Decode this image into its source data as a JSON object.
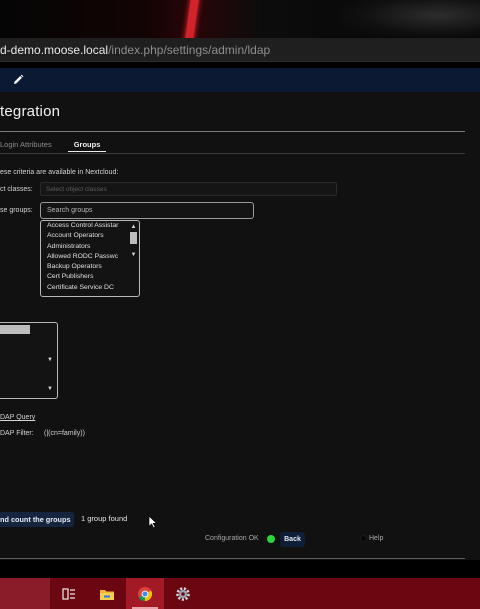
{
  "browser": {
    "url_host": "d-demo.moose.local",
    "url_path": "/index.php/settings/admin/ldap"
  },
  "header": {
    "edit_icon": "pencil-icon"
  },
  "page": {
    "title": "tegration",
    "tabs": [
      {
        "label": "Login Attributes",
        "active": false
      },
      {
        "label": "Groups",
        "active": true
      }
    ],
    "description": "ese criteria are available in Nextcloud:",
    "object_classes_label": "ct classes:",
    "object_classes_placeholder": "Select object classes",
    "groups_label": "se groups:",
    "search_placeholder": "Search groups",
    "available_groups": [
      "Access Control Assistar",
      "Account Operators",
      "Administrators",
      "Allowed RODC Passwc",
      "Backup Operators",
      "Cert Publishers",
      "Certificate Service DC"
    ],
    "edit_ldap_query": "DAP Query",
    "ldap_filter_label": "DAP Filter:",
    "ldap_filter_value": "(|(cn=family))",
    "verify_button": "nd count the groups",
    "groups_found": "1 group found",
    "config_status": "Configuration OK",
    "back_button": "Back",
    "help": "Help"
  },
  "colors": {
    "status_ok": "#2ad43a",
    "header_bg": "#0b1a32",
    "taskbar_bg": "#6a0711"
  },
  "taskbar": {
    "items": [
      "task-view-icon",
      "file-explorer-icon",
      "chrome-icon",
      "settings-icon"
    ]
  }
}
